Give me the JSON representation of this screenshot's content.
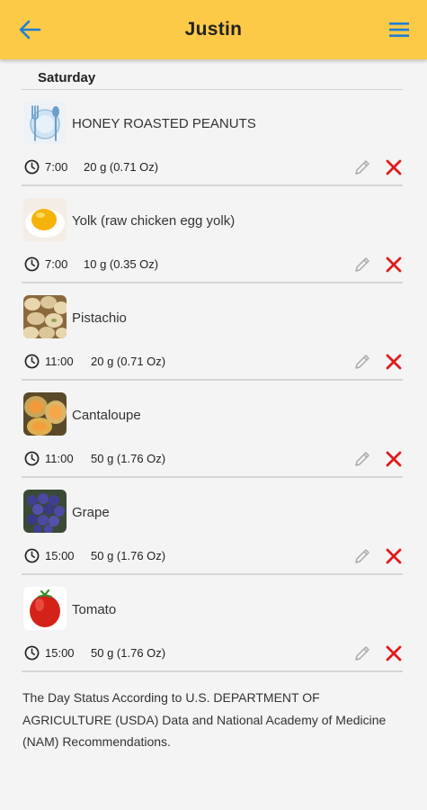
{
  "header": {
    "title": "Justin",
    "back_icon": "arrow-left-icon",
    "menu_icon": "hamburger-menu-icon",
    "bar_color": "#fcca47",
    "icon_color": "#1f7fd6"
  },
  "day": {
    "label": "Saturday"
  },
  "entries": [
    {
      "name": "HONEY ROASTED PEANUTS",
      "time": "7:00",
      "amount": "20 g (0.71 Oz)",
      "image": "fork-spoon-plate-placeholder"
    },
    {
      "name": "Yolk (raw chicken egg yolk)",
      "time": "7:00",
      "amount": "10 g (0.35 Oz)",
      "image": "egg-yolk-photo"
    },
    {
      "name": "Pistachio",
      "time": "11:00",
      "amount": "20 g (0.71 Oz)",
      "image": "pistachio-photo"
    },
    {
      "name": "Cantaloupe",
      "time": "11:00",
      "amount": "50 g (1.76 Oz)",
      "image": "cantaloupe-photo"
    },
    {
      "name": "Grape",
      "time": "15:00",
      "amount": "50 g (1.76 Oz)",
      "image": "grape-photo"
    },
    {
      "name": "Tomato",
      "time": "15:00",
      "amount": "50 g (1.76 Oz)",
      "image": "tomato-photo"
    }
  ],
  "entry_actions": {
    "edit_icon": "pencil-icon",
    "delete_icon": "close-x-icon",
    "delete_color": "#e01b1b"
  },
  "footer": {
    "note": "The Day Status According to U.S. DEPARTMENT OF AGRICULTURE (USDA) Data and National Academy of Medicine (NAM) Recommendations."
  }
}
